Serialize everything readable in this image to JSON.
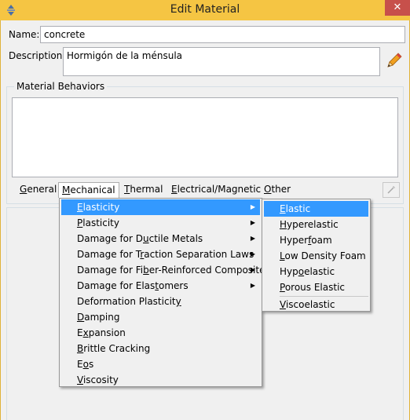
{
  "window": {
    "title": "Edit Material",
    "close_glyph": "✕"
  },
  "name": {
    "label": "Name:",
    "value": "concrete"
  },
  "description": {
    "label": "Description:",
    "value": "Hormigón de la ménsula"
  },
  "behaviors": {
    "title": "Material Behaviors"
  },
  "menubar": [
    {
      "key": "general",
      "pre": "",
      "u": "G",
      "post": "eneral"
    },
    {
      "key": "mechanical",
      "pre": "",
      "u": "M",
      "post": "echanical"
    },
    {
      "key": "thermal",
      "pre": "",
      "u": "T",
      "post": "hermal"
    },
    {
      "key": "electrical",
      "pre": "",
      "u": "E",
      "post": "lectrical/Magnetic"
    },
    {
      "key": "other",
      "pre": "",
      "u": "O",
      "post": "ther"
    }
  ],
  "mechanical_menu": [
    {
      "pre": "",
      "u": "E",
      "post": "lasticity",
      "sub": true,
      "hl": true
    },
    {
      "pre": "",
      "u": "P",
      "post": "lasticity",
      "sub": true
    },
    {
      "pre": "Damage for D",
      "u": "u",
      "post": "ctile Metals",
      "sub": true
    },
    {
      "pre": "Damage for T",
      "u": "r",
      "post": "action Separation Laws",
      "sub": true
    },
    {
      "pre": "Damage for Fi",
      "u": "b",
      "post": "er-Reinforced Composites",
      "sub": true
    },
    {
      "pre": "Damage for Elas",
      "u": "t",
      "post": "omers",
      "sub": true
    },
    {
      "pre": "Deformation Plasticit",
      "u": "y",
      "post": "",
      "sub": false
    },
    {
      "pre": "",
      "u": "D",
      "post": "amping",
      "sub": false
    },
    {
      "pre": "E",
      "u": "x",
      "post": "pansion",
      "sub": false
    },
    {
      "pre": "",
      "u": "B",
      "post": "rittle Cracking",
      "sub": false
    },
    {
      "pre": "E",
      "u": "o",
      "post": "s",
      "sub": false
    },
    {
      "pre": "",
      "u": "V",
      "post": "iscosity",
      "sub": false
    }
  ],
  "elasticity_submenu": [
    {
      "pre": "",
      "u": "E",
      "post": "lastic",
      "hl": true
    },
    {
      "pre": "",
      "u": "H",
      "post": "yperelastic"
    },
    {
      "pre": "Hyper",
      "u": "f",
      "post": "oam"
    },
    {
      "pre": "",
      "u": "L",
      "post": "ow Density Foam"
    },
    {
      "pre": "Hyp",
      "u": "o",
      "post": "elastic"
    },
    {
      "pre": "",
      "u": "P",
      "post": "orous Elastic"
    },
    {
      "pre": "",
      "u": "V",
      "post": "iscoelastic",
      "sep_before": true
    }
  ],
  "colors": {
    "titlebar": "#f5c543",
    "highlight": "#3399ff",
    "close": "#c7504b"
  }
}
